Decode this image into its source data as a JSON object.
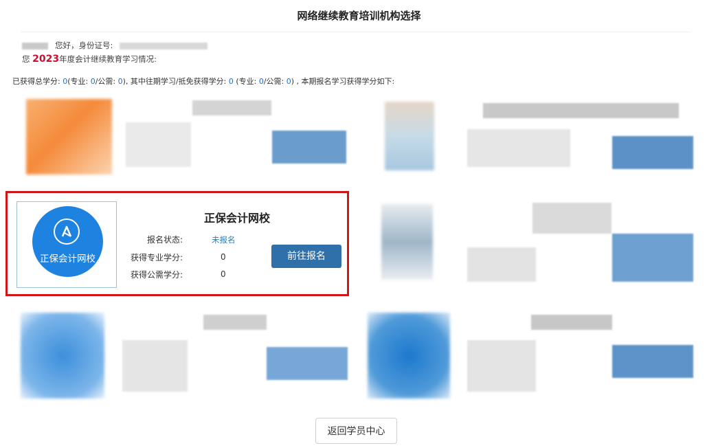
{
  "page": {
    "title": "网络继续教育培训机构选择"
  },
  "user": {
    "greeting": "您好，身份证号:"
  },
  "year_line": {
    "prefix": "您",
    "year": "2023",
    "suffix": "年度会计继续教育学习情况:"
  },
  "credits": {
    "text_a": "已获得总学分: ",
    "total": "0",
    "text_b": "(专业: ",
    "professional": "0",
    "text_c": "/公需: ",
    "public": "0",
    "text_d": "), 其中往期学习/抵免获得学分: ",
    "prior": "0",
    "text_e": " (专业: ",
    "prior_professional": "0",
    "text_f": "/公需: ",
    "prior_public": "0",
    "text_g": ") , 本期报名学习获得学分如下:"
  },
  "institution": {
    "name": "正保会计网校",
    "logo_text": "正保会计网校",
    "status_label": "报名状态:",
    "status_value": "未报名",
    "prof_label": "获得专业学分:",
    "prof_value": "0",
    "public_label": "获得公需学分:",
    "public_value": "0",
    "enroll_button": "前往报名"
  },
  "footer": {
    "back_button": "返回学员中心"
  },
  "colors": {
    "highlight_border": "#d21414",
    "logo_blue": "#1e82e0",
    "button_blue": "#2f6faa",
    "year_red": "#c8102e",
    "status_blue": "#2a7db0"
  }
}
